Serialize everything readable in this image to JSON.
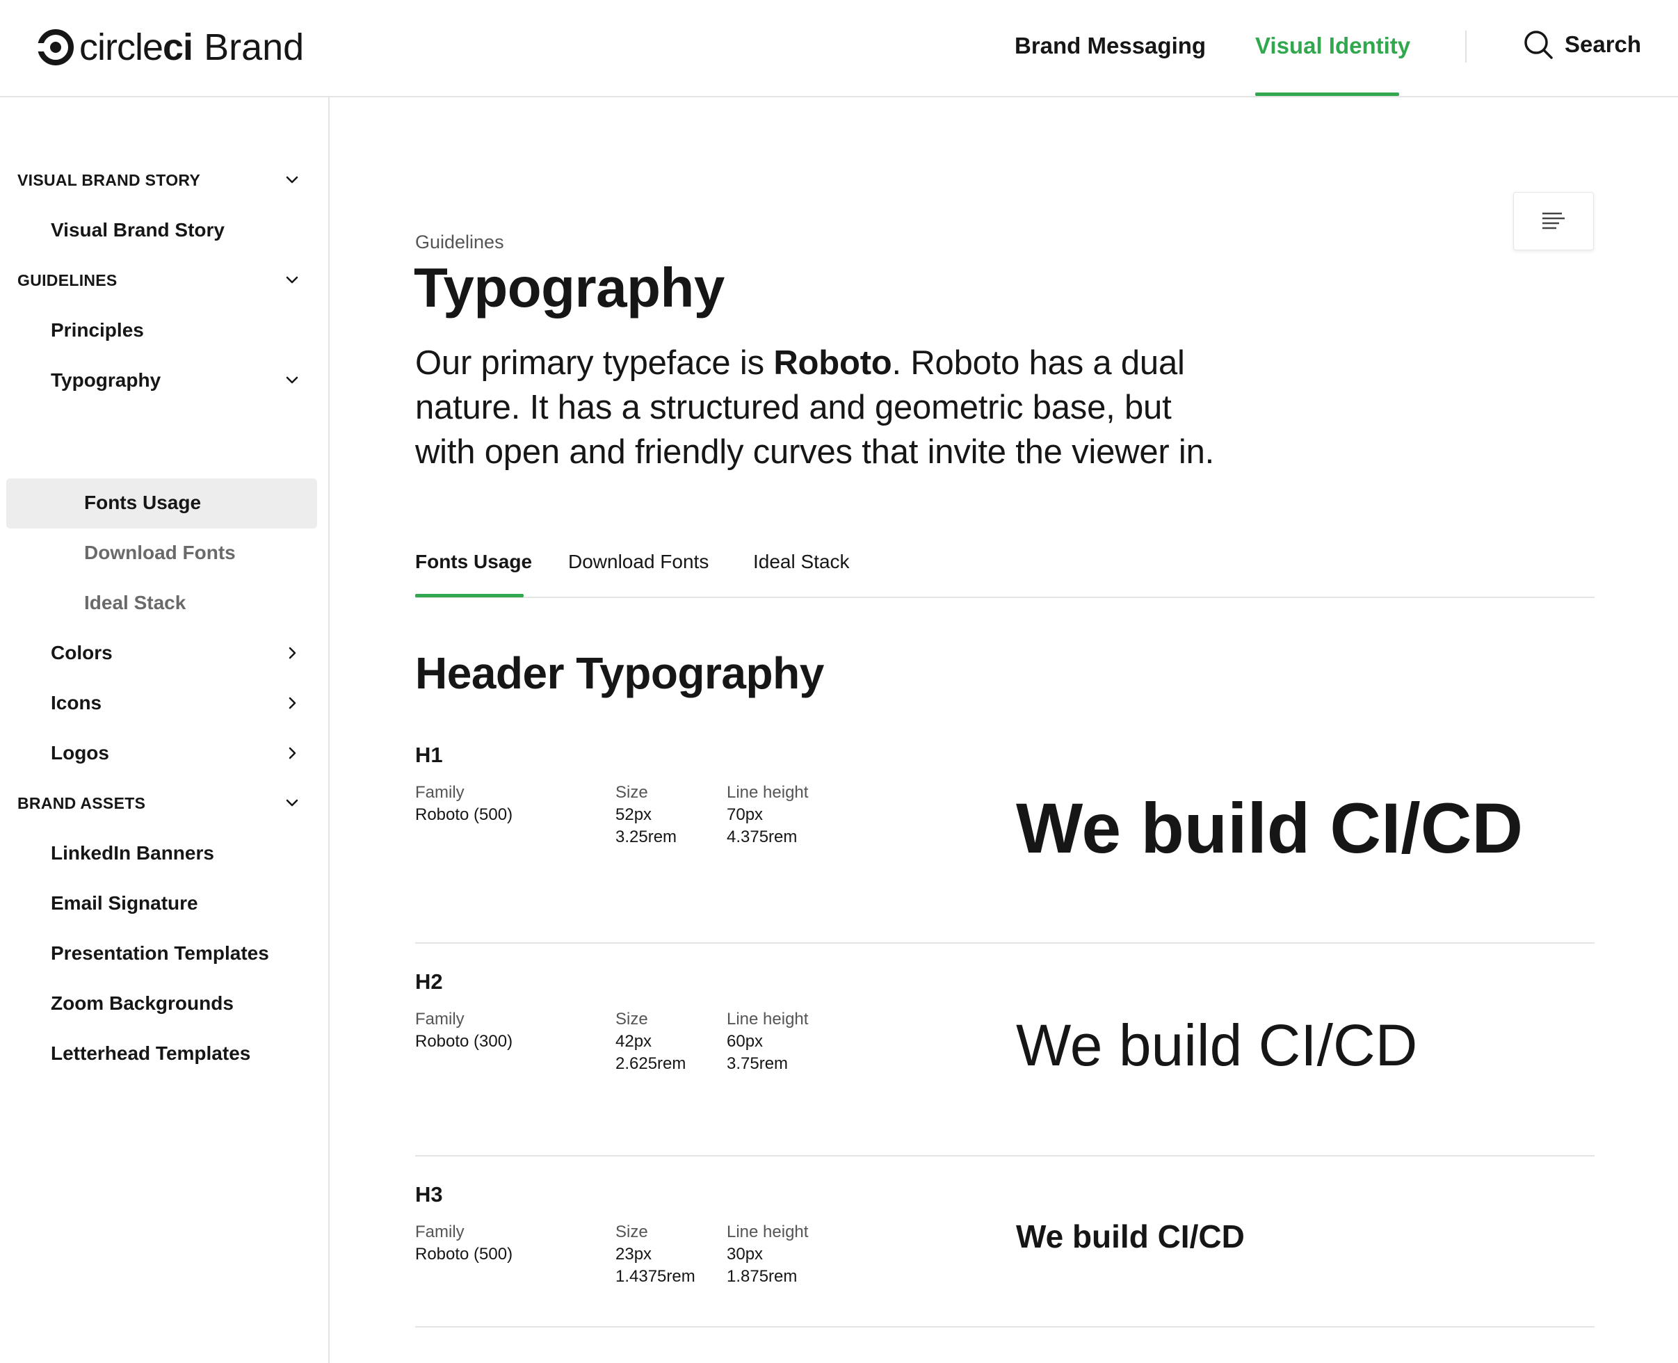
{
  "header": {
    "logo_word_light": "circle",
    "logo_word_bold": "ci",
    "logo_brand": "Brand",
    "nav": [
      {
        "label": "Brand Messaging",
        "active": false
      },
      {
        "label": "Visual Identity",
        "active": true
      }
    ],
    "search_label": "Search",
    "accent_color": "#31a84e"
  },
  "sidebar": {
    "sections": [
      {
        "label": "VISUAL BRAND STORY",
        "expanded": true,
        "items": [
          {
            "label": "Visual Brand Story"
          }
        ]
      },
      {
        "label": "GUIDELINES",
        "expanded": true,
        "items": [
          {
            "label": "Principles"
          },
          {
            "label": "Typography",
            "expanded": true,
            "children": [
              {
                "label": "Fonts Usage",
                "current": true
              },
              {
                "label": "Download Fonts"
              },
              {
                "label": "Ideal Stack"
              }
            ]
          },
          {
            "label": "Colors",
            "expanded": false
          },
          {
            "label": "Icons",
            "expanded": false
          },
          {
            "label": "Logos",
            "expanded": false
          }
        ]
      },
      {
        "label": "BRAND ASSETS",
        "expanded": true,
        "items": [
          {
            "label": "LinkedIn Banners"
          },
          {
            "label": "Email Signature"
          },
          {
            "label": "Presentation Templates"
          },
          {
            "label": "Zoom Backgrounds"
          },
          {
            "label": "Letterhead Templates"
          }
        ]
      }
    ]
  },
  "main": {
    "toc_icon": "table-of-contents-icon",
    "eyebrow": "Guidelines",
    "title": "Typography",
    "intro_before": "Our primary typeface is ",
    "intro_bold": "Roboto",
    "intro_after": ". Roboto has a dual nature. It has a structured and geometric base, but with open and friendly curves that invite the viewer in.",
    "tabs": [
      {
        "label": "Fonts Usage",
        "active": true
      },
      {
        "label": "Download Fonts",
        "active": false
      },
      {
        "label": "Ideal Stack",
        "active": false
      }
    ],
    "section_title": "Header Typography",
    "labels": {
      "family": "Family",
      "size": "Size",
      "line_height": "Line height"
    },
    "specs": [
      {
        "name": "H1",
        "family": "Roboto (500)",
        "size_px": "52px",
        "size_rem": "3.25rem",
        "lh_px": "70px",
        "lh_rem": "4.375rem",
        "sample": "We build CI/CD"
      },
      {
        "name": "H2",
        "family": "Roboto (300)",
        "size_px": "42px",
        "size_rem": "2.625rem",
        "lh_px": "60px",
        "lh_rem": "3.75rem",
        "sample": "We build CI/CD"
      },
      {
        "name": "H3",
        "family": "Roboto (500)",
        "size_px": "23px",
        "size_rem": "1.4375rem",
        "lh_px": "30px",
        "lh_rem": "1.875rem",
        "sample": "We build CI/CD"
      }
    ]
  }
}
